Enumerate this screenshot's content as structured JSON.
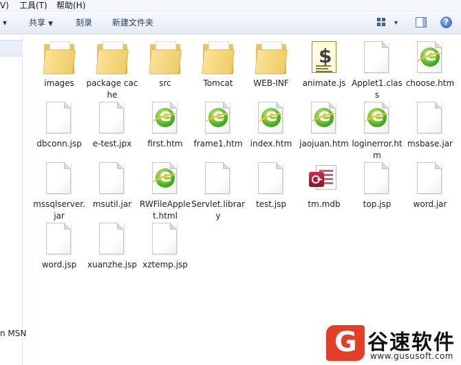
{
  "menubar": {
    "view": "V)",
    "tools": "工具(T)",
    "help": "帮助(H)"
  },
  "toolbar": {
    "organize_caret": "▾",
    "share": "共享",
    "burn": "刻录",
    "new_folder": "新建文件夹",
    "view_caret": "▾",
    "help_glyph": "?"
  },
  "icons": {
    "view": "view-grid-icon",
    "preview_pane": "preview-pane-icon",
    "help": "help-icon"
  },
  "nav": {
    "msn": "n MSN"
  },
  "files": [
    {
      "name": "images",
      "type": "folder-images"
    },
    {
      "name": "package cache",
      "type": "folder"
    },
    {
      "name": "src",
      "type": "folder"
    },
    {
      "name": "Tomcat",
      "type": "folder"
    },
    {
      "name": "WEB-INF",
      "type": "folder"
    },
    {
      "name": "animate.js",
      "type": "script"
    },
    {
      "name": "Applet1.class",
      "type": "file"
    },
    {
      "name": "choose.htm",
      "type": "htm"
    },
    {
      "name": "dbconn.jsp",
      "type": "file"
    },
    {
      "name": "e-test.jpx",
      "type": "file"
    },
    {
      "name": "first.htm",
      "type": "htm"
    },
    {
      "name": "frame1.htm",
      "type": "htm"
    },
    {
      "name": "index.htm",
      "type": "htm"
    },
    {
      "name": "jaojuan.htm",
      "type": "htm"
    },
    {
      "name": "loginerror.htm",
      "type": "htm"
    },
    {
      "name": "msbase.jar",
      "type": "file"
    },
    {
      "name": "mssqlserver.jar",
      "type": "file"
    },
    {
      "name": "msutil.jar",
      "type": "file"
    },
    {
      "name": "RWFileApplet.html",
      "type": "htm"
    },
    {
      "name": "Servlet.library",
      "type": "file"
    },
    {
      "name": "test.jsp",
      "type": "file"
    },
    {
      "name": "tm.mdb",
      "type": "mdb"
    },
    {
      "name": "top.jsp",
      "type": "file"
    },
    {
      "name": "word.jar",
      "type": "file"
    },
    {
      "name": "word.jsp",
      "type": "file"
    },
    {
      "name": "xuanzhe.jsp",
      "type": "file"
    },
    {
      "name": "xztemp.jsp",
      "type": "file"
    }
  ],
  "watermark": {
    "brand": "谷速软件",
    "url": "www.gususoft.com"
  }
}
